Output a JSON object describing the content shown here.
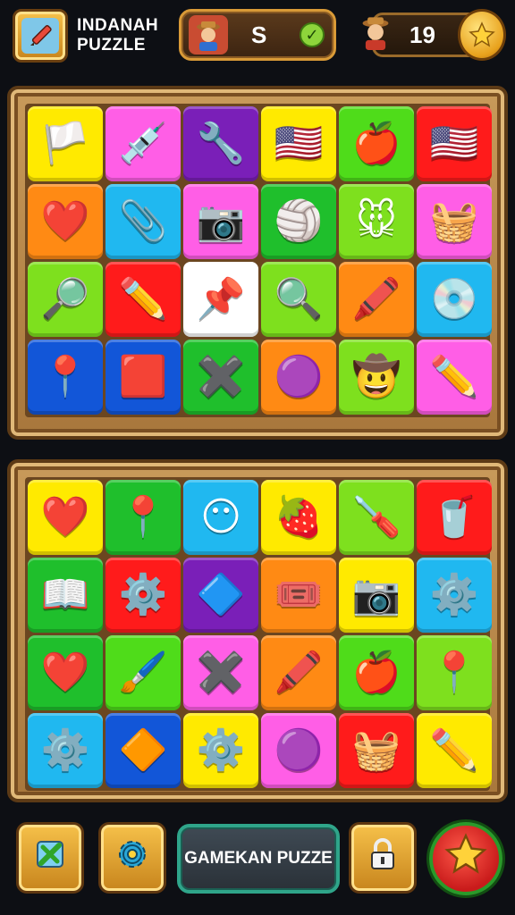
{
  "header": {
    "title": "INDANAH PUZZLE",
    "app_icon": "pencil-icon",
    "stat_left": {
      "value": "S",
      "avatar_icon": "farmer-avatar-icon",
      "status_icon": "check-icon"
    },
    "stat_right": {
      "value": "19",
      "avatar_icon": "farmer-avatar-icon",
      "badge_icon": "star-gem-icon"
    }
  },
  "top_board": {
    "tiles": [
      {
        "icon": "flag-icon",
        "glyph": "🏳️",
        "color": "#ffea00"
      },
      {
        "icon": "syringe-icon",
        "glyph": "💉",
        "color": "#ff5ee6"
      },
      {
        "icon": "wrench-icon",
        "glyph": "🔧",
        "color": "#7a1fb8"
      },
      {
        "icon": "us-flag-icon",
        "glyph": "🇺🇸",
        "color": "#ffea00"
      },
      {
        "icon": "apple-icon",
        "glyph": "🍎",
        "color": "#4fdc1a"
      },
      {
        "icon": "us-flag-icon",
        "glyph": "🇺🇸",
        "color": "#ff1b1b"
      },
      {
        "icon": "heart-icon",
        "glyph": "❤️",
        "color": "#ff8a14"
      },
      {
        "icon": "stapler-icon",
        "glyph": "📎",
        "color": "#20b8f0"
      },
      {
        "icon": "camera-icon",
        "glyph": "📷",
        "color": "#ff5ee6"
      },
      {
        "icon": "ball-badge-icon",
        "glyph": "🏐",
        "color": "#1fbf2c"
      },
      {
        "icon": "bear-face-icon",
        "glyph": "🐭",
        "color": "#7ee01e"
      },
      {
        "icon": "basket-icon",
        "glyph": "🧺",
        "color": "#ff5ee6"
      },
      {
        "icon": "magnifier-icon",
        "glyph": "🔎",
        "color": "#7ee01e"
      },
      {
        "icon": "pencil-icon",
        "glyph": "✏️",
        "color": "#ff1b1b"
      },
      {
        "icon": "pushpin-icon",
        "glyph": "📌",
        "color": "#ffffff"
      },
      {
        "icon": "magnifier-icon",
        "glyph": "🔍",
        "color": "#7ee01e"
      },
      {
        "icon": "pencil-icon",
        "glyph": "🖍️",
        "color": "#ff8a14"
      },
      {
        "icon": "disc-icon",
        "glyph": "💿",
        "color": "#20b8f0"
      },
      {
        "icon": "map-pin-icon",
        "glyph": "📍",
        "color": "#1256d8"
      },
      {
        "icon": "flag-icon",
        "glyph": "🟥",
        "color": "#1256d8"
      },
      {
        "icon": "x-mark-icon",
        "glyph": "✖️",
        "color": "#1fbf2c"
      },
      {
        "icon": "disc-icon",
        "glyph": "🟣",
        "color": "#ff8a14"
      },
      {
        "icon": "scarecrow-icon",
        "glyph": "🤠",
        "color": "#7ee01e"
      },
      {
        "icon": "pencil-icon",
        "glyph": "✏️",
        "color": "#ff5ee6"
      }
    ]
  },
  "bottom_board": {
    "tiles": [
      {
        "icon": "heart-icon",
        "glyph": "❤️",
        "color": "#ffea00"
      },
      {
        "icon": "map-pin-icon",
        "glyph": "📍",
        "color": "#1fbf2c"
      },
      {
        "icon": "face-blob-icon",
        "glyph": "😶",
        "color": "#20b8f0"
      },
      {
        "icon": "strawberry-icon",
        "glyph": "🍓",
        "color": "#ffea00"
      },
      {
        "icon": "tool-icon",
        "glyph": "🪛",
        "color": "#7ee01e"
      },
      {
        "icon": "cup-icon",
        "glyph": "🥤",
        "color": "#ff1b1b"
      },
      {
        "icon": "book-icon",
        "glyph": "📖",
        "color": "#1fbf2c"
      },
      {
        "icon": "gear-icon",
        "glyph": "⚙️",
        "color": "#ff1b1b"
      },
      {
        "icon": "shovel-icon",
        "glyph": "🔷",
        "color": "#7a1fb8"
      },
      {
        "icon": "badge-icon",
        "glyph": "🎟️",
        "color": "#ff8a14"
      },
      {
        "icon": "camera-icon",
        "glyph": "📷",
        "color": "#ffea00"
      },
      {
        "icon": "gear-icon",
        "glyph": "⚙️",
        "color": "#20b8f0"
      },
      {
        "icon": "heart-icon",
        "glyph": "❤️",
        "color": "#1fbf2c"
      },
      {
        "icon": "brush-icon",
        "glyph": "🖌️",
        "color": "#4fdc1a"
      },
      {
        "icon": "x-mark-icon",
        "glyph": "✖️",
        "color": "#ff5ee6"
      },
      {
        "icon": "pencil-icon",
        "glyph": "🖍️",
        "color": "#ff8a14"
      },
      {
        "icon": "apple-icon",
        "glyph": "🍎",
        "color": "#4fdc1a"
      },
      {
        "icon": "needle-icon",
        "glyph": "📍",
        "color": "#7ee01e"
      },
      {
        "icon": "gear-icon",
        "glyph": "⚙️",
        "color": "#20b8f0"
      },
      {
        "icon": "shield-icon",
        "glyph": "🔶",
        "color": "#1256d8"
      },
      {
        "icon": "gear-icon",
        "glyph": "⚙️",
        "color": "#ffea00"
      },
      {
        "icon": "disc-icon",
        "glyph": "🟣",
        "color": "#ff5ee6"
      },
      {
        "icon": "basket-icon",
        "glyph": "🧺",
        "color": "#ff1b1b"
      },
      {
        "icon": "pencil-icon",
        "glyph": "✏️",
        "color": "#ffea00"
      }
    ]
  },
  "bottom_bar": {
    "main_label": "GAMEKAN PUZZE",
    "edit_icon": "edit-icon",
    "settings_icon": "gear-icon",
    "lock_icon": "lock-icon",
    "star_icon": "star-icon"
  }
}
